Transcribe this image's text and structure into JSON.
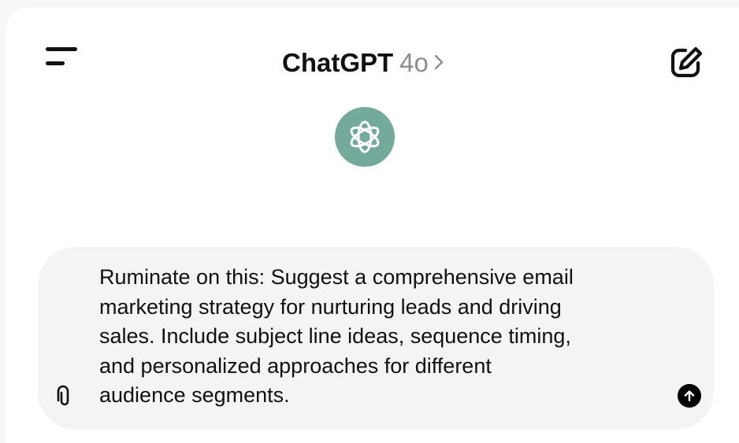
{
  "header": {
    "app_name": "ChatGPT",
    "model_label": "4o",
    "menu_icon": "hamburger-menu-icon",
    "model_chevron_icon": "chevron-right-icon",
    "new_chat_icon": "edit-pencil-icon"
  },
  "logo": {
    "icon": "openai-logo-icon",
    "color": "#74aa9c"
  },
  "composer": {
    "text": "Ruminate on this: Suggest a comprehensive email\nmarketing strategy for nurturing leads and driving\nsales. Include subject line ideas, sequence timing,\nand personalized approaches for different\naudience segments.",
    "attach_icon": "paperclip-icon",
    "send_icon": "arrow-up-icon"
  }
}
